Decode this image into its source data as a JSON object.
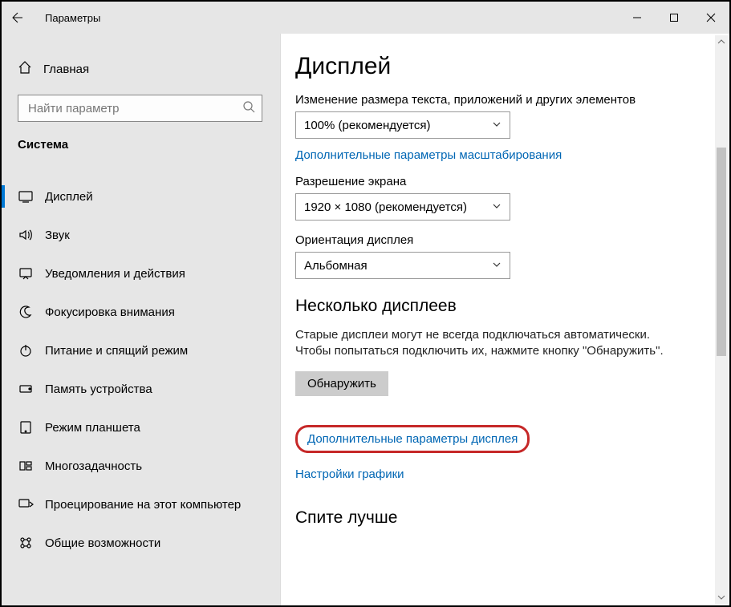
{
  "window": {
    "title": "Параметры"
  },
  "sidebar": {
    "home": "Главная",
    "search_placeholder": "Найти параметр",
    "group": "Система",
    "items": [
      {
        "label": "Дисплей"
      },
      {
        "label": "Звук"
      },
      {
        "label": "Уведомления и действия"
      },
      {
        "label": "Фокусировка внимания"
      },
      {
        "label": "Питание и спящий режим"
      },
      {
        "label": "Память устройства"
      },
      {
        "label": "Режим планшета"
      },
      {
        "label": "Многозадачность"
      },
      {
        "label": "Проецирование на этот компьютер"
      },
      {
        "label": "Общие возможности"
      }
    ]
  },
  "content": {
    "title": "Дисплей",
    "scale_label": "Изменение размера текста, приложений и других элементов",
    "scale_value": "100% (рекомендуется)",
    "scale_link": "Дополнительные параметры масштабирования",
    "resolution_label": "Разрешение экрана",
    "resolution_value": "1920 × 1080 (рекомендуется)",
    "orientation_label": "Ориентация дисплея",
    "orientation_value": "Альбомная",
    "multi_title": "Несколько дисплеев",
    "multi_help": "Старые дисплеи могут не всегда подключаться автоматически. Чтобы попытаться подключить их, нажмите кнопку \"Обнаружить\".",
    "detect_btn": "Обнаружить",
    "adv_display_link": "Дополнительные параметры дисплея",
    "graphics_link": "Настройки графики",
    "sleep_title": "Спите лучше"
  }
}
